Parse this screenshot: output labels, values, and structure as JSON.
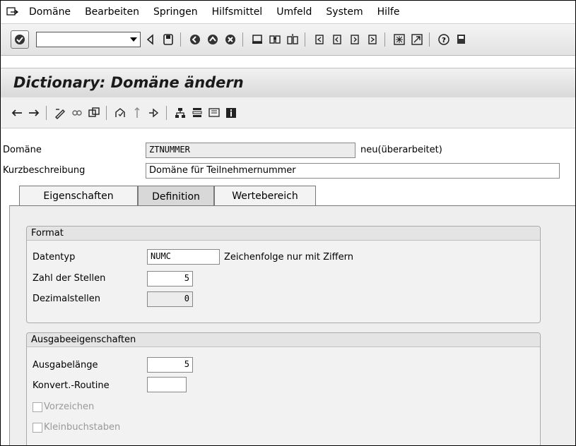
{
  "menu": {
    "items": [
      {
        "label": "Domäne"
      },
      {
        "label": "Bearbeiten"
      },
      {
        "label": "Springen"
      },
      {
        "label": "Hilfsmittel"
      },
      {
        "label": "Umfeld"
      },
      {
        "label": "System"
      },
      {
        "label": "Hilfe"
      }
    ]
  },
  "toolbar": {
    "command_field_value": "",
    "icons": [
      "enter-icon",
      "back-arrow-icon",
      "save-icon",
      "back-icon",
      "exit-icon",
      "cancel-icon",
      "print-icon",
      "find-icon",
      "find-next-icon",
      "first-page-icon",
      "previous-page-icon",
      "next-page-icon",
      "last-page-icon",
      "new-session-icon",
      "shortcut-icon",
      "help-icon",
      "layout-icon"
    ]
  },
  "title": "Dictionary: Domäne ändern",
  "header": {
    "domain_label": "Domäne",
    "domain_value": "ZTNUMMER",
    "domain_status": "neu(überarbeitet)",
    "short_desc_label": "Kurzbeschreibung",
    "short_desc_value": "Domäne für Teilnehmernummer"
  },
  "tabs": [
    {
      "label": "Eigenschaften",
      "active": false
    },
    {
      "label": "Definition",
      "active": true
    },
    {
      "label": "Wertebereich",
      "active": false
    }
  ],
  "format": {
    "title": "Format",
    "datatype_label": "Datentyp",
    "datatype_value": "NUMC",
    "datatype_desc": "Zeichenfolge nur mit Ziffern",
    "length_label": "Zahl der Stellen",
    "length_value": "5",
    "decimals_label": "Dezimalstellen",
    "decimals_value": "0"
  },
  "output": {
    "title": "Ausgabeeigenschaften",
    "outlen_label": "Ausgabelänge",
    "outlen_value": "5",
    "conv_label": "Konvert.-Routine",
    "conv_value": "",
    "sign_label": "Vorzeichen",
    "lowercase_label": "Kleinbuchstaben"
  }
}
